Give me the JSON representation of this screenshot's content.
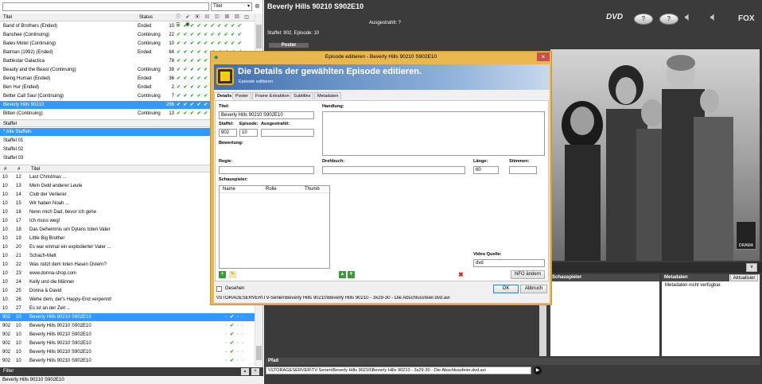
{
  "filter_placeholder": "",
  "filter_select": "Titel",
  "series": {
    "headers": {
      "title": "Titel",
      "status": "Status"
    },
    "rows": [
      {
        "title": "Band of Brothers (Ended)",
        "status": "Ended",
        "count": "10"
      },
      {
        "title": "Banshee (Continuing)",
        "status": "Continuing",
        "count": "22"
      },
      {
        "title": "Bates Motel (Continuing)",
        "status": "Continuing",
        "count": "10"
      },
      {
        "title": "Batman (1992) (Ended)",
        "status": "Ended",
        "count": "84"
      },
      {
        "title": "Battlestar Galactica",
        "status": "",
        "count": "78"
      },
      {
        "title": "Beauty and the Beast (Continuing)",
        "status": "Continuing",
        "count": "39"
      },
      {
        "title": "Being Human (Ended)",
        "status": "Ended",
        "count": "36"
      },
      {
        "title": "Ben Hur (Ended)",
        "status": "Ended",
        "count": "2"
      },
      {
        "title": "Better Call Saul (Continuing)",
        "status": "Continuing",
        "count": "7"
      },
      {
        "title": "Beverly Hills 90210",
        "status": "",
        "count": "286"
      },
      {
        "title": "Bitten (Continuing)",
        "status": "Continuing",
        "count": "13"
      }
    ]
  },
  "seasons": {
    "header": "Staffel",
    "rows": [
      "* Alle Staffeln",
      "Staffel 01",
      "Staffel 02",
      "Staffel 03"
    ]
  },
  "episodes": {
    "headers": {
      "s": "#",
      "e": "#",
      "title": "Titel"
    },
    "rows": [
      {
        "s": "10",
        "e": "12",
        "title": "Last Christmas ..."
      },
      {
        "s": "10",
        "e": "13",
        "title": "Mein Geld anderer Leute"
      },
      {
        "s": "10",
        "e": "14",
        "title": "Club der Verlierer"
      },
      {
        "s": "10",
        "e": "15",
        "title": "Wir haben Noah ..."
      },
      {
        "s": "10",
        "e": "16",
        "title": "Nenn mich Dad, bevor ich gehe"
      },
      {
        "s": "10",
        "e": "17",
        "title": "Ich muss weg!"
      },
      {
        "s": "10",
        "e": "18",
        "title": "Das Geheimnis um Dylans toten Vater"
      },
      {
        "s": "10",
        "e": "19",
        "title": "Little Big Brother"
      },
      {
        "s": "10",
        "e": "20",
        "title": "Es war einmal ein explodierter Vater ..."
      },
      {
        "s": "10",
        "e": "21",
        "title": "Schach-Matt"
      },
      {
        "s": "10",
        "e": "22",
        "title": "Was nützt dem toten Hasen Ostern?"
      },
      {
        "s": "10",
        "e": "23",
        "title": "www.donna-shop.com"
      },
      {
        "s": "10",
        "e": "24",
        "title": "Kelly und die Männer"
      },
      {
        "s": "10",
        "e": "25",
        "title": "Donna & David"
      },
      {
        "s": "10",
        "e": "26",
        "title": "Wehe dem, der's Happy-End verpennt!"
      },
      {
        "s": "10",
        "e": "27",
        "title": "Es ist an der Zeit ..."
      },
      {
        "s": "902",
        "e": "10",
        "title": "Beverly Hills 90210 S902E10"
      },
      {
        "s": "902",
        "e": "10",
        "title": "Beverly Hills 90210 S902E10"
      },
      {
        "s": "902",
        "e": "10",
        "title": "Beverly Hills 90210 S902E10"
      },
      {
        "s": "902",
        "e": "10",
        "title": "Beverly Hills 90210 S902E10"
      },
      {
        "s": "902",
        "e": "10",
        "title": "Beverly Hills 90210 S902E10"
      },
      {
        "s": "902",
        "e": "10",
        "title": "Beverly Hills 90210 S902E10"
      },
      {
        "s": "902",
        "e": "10",
        "title": "Beverly Hills 90210 S902E10"
      }
    ]
  },
  "filter_bar": "Filter",
  "status_bar": "Beverly Hills 90210 S902E10",
  "right": {
    "title": "Beverly Hills 90210 S902E10",
    "aired_label": "Ausgestrahlt: ?",
    "season_episode": "Staffel: 902, Episode: 10",
    "poster_label": "Poster",
    "fox": "FOX",
    "dvd": "DVD",
    "drama": "DRAMA",
    "path_header": "Pfad",
    "path_value": "\\\\STORAGESERVER\\TV-Serien\\Beverly Hills 90210\\Beverly Hills 90210 - 3x29-30 - Die Abschlussfeier.dvd.avi",
    "actors_header": "Schauspieler",
    "meta_header": "Metadaten",
    "meta_btn": "Aktualisier",
    "meta_text": "Metadaten nicht verfügbar.",
    "v_btn": "v"
  },
  "dialog": {
    "title": "Episode editieren - Beverly Hills 90210 S902E10",
    "banner_title": "Die Details der gewählten Episode editieren.",
    "banner_sub": "Episode editieren",
    "tabs": [
      "Details",
      "Poster",
      "Frame Extraktion",
      "Subtitles",
      "Metadaten"
    ],
    "labels": {
      "titel": "Titel:",
      "handlung": "Handlung:",
      "staffel": "Staffel:",
      "episode": "Episode:",
      "ausgestrahlt": "Ausgestrahlt:",
      "bewertung": "Bewertung:",
      "regie": "Regie:",
      "drehbuch": "Drehbuch:",
      "laenge": "Länge:",
      "stimmen": "Stimmen:",
      "schauspieler": "Schauspieler:",
      "videoquelle": "Video Quelle:"
    },
    "values": {
      "titel": "Beverly Hills 90210 S902E10",
      "staffel": "902",
      "episode": "10",
      "ausgestrahlt": "",
      "regie": "",
      "drehbuch": "",
      "laenge": "60",
      "stimmen": "",
      "videoquelle": "dvd"
    },
    "actor_cols": [
      "Name",
      "Rolle",
      "Thumb"
    ],
    "nfo_btn": "NFO ändern",
    "gesehen": "Gesehen",
    "path": "\\\\STORAGESERVER\\TV-Serien\\Beverly Hills 90210\\Beverly Hills 90210 - 3x29-30 - Die Abschlussfeier.dvd.avi",
    "ok": "OK",
    "cancel": "Abbruch"
  },
  "colors": {
    "selection": "#3399ff",
    "check": "#1fa22d",
    "dialog_frame": "#e8b84e",
    "dark_bar": "#3b3b3b"
  }
}
